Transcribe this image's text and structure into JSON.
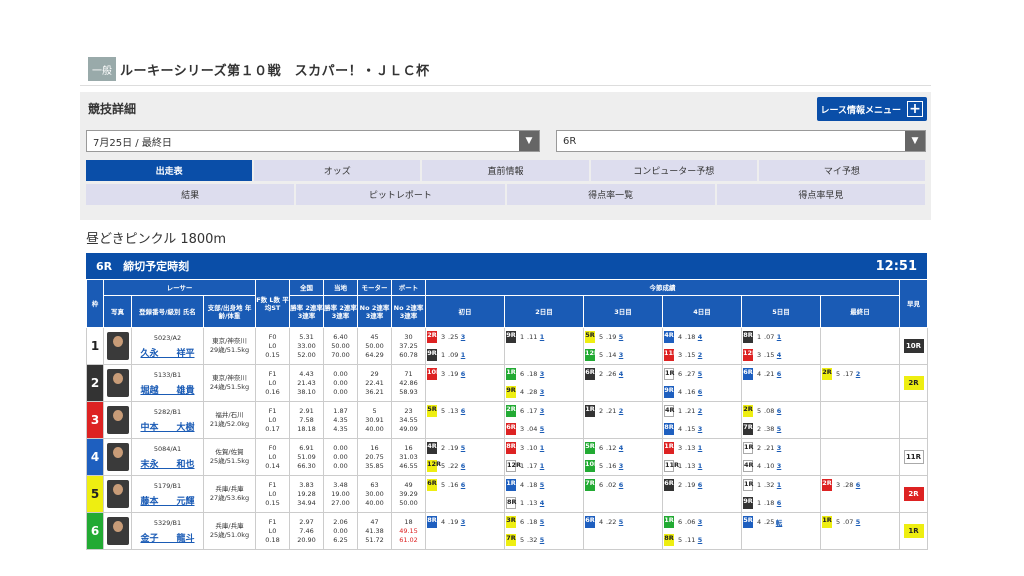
{
  "header": {
    "badge": "一般",
    "title": "ルーキーシリーズ第１０戦　スカパー！・ＪＬＣ杯"
  },
  "panel": {
    "title": "競技詳細",
    "menu_label": "レース情報メニュー",
    "date_select": "7月25日 / 最終日",
    "race_select": "6R"
  },
  "tabs_row1": [
    "出走表",
    "オッズ",
    "直前情報",
    "コンピューター予想",
    "マイ予想"
  ],
  "tabs_row2": [
    "結果",
    "ピットレポート",
    "得点率一覧",
    "得点率早見"
  ],
  "course": "昼どきピンクル 1800m",
  "racebar": {
    "label": "6R　締切予定時刻",
    "time": "12:51"
  },
  "table_headers": {
    "waku": "枠",
    "racer": "レーサー",
    "photo": "写真",
    "reg": "登録番号/級別 氏名",
    "branch": "支部/出身地 年齢/体重",
    "fl": "F数 L数 平均ST",
    "zenkoku": "全国",
    "touchi": "当地",
    "motor": "モーター",
    "boat": "ボート",
    "konsetsu": "今節成績",
    "rate1": "勝率 2連率 3連率",
    "rate2": "勝率 2連率 3連率",
    "rate3": "No 2連率 3連率",
    "rate4": "No 2連率 3連率",
    "days": [
      "初日",
      "2日目",
      "3日目",
      "4日目",
      "5日目",
      "最終日"
    ],
    "hayami": "早見"
  },
  "racers": [
    {
      "lane": "1",
      "reg": "5023/A2",
      "name": "久永　　祥平",
      "branch": "東京/神奈川",
      "age": "29歳/51.5kg",
      "f": "F0",
      "l": "L0",
      "st": "0.15",
      "zk": [
        "5.31",
        "33.00",
        "52.00"
      ],
      "tc": [
        "6.40",
        "50.00",
        "70.00"
      ],
      "mo": [
        "45",
        "50.00",
        "64.29"
      ],
      "bo": [
        "30",
        "37.25",
        "60.78"
      ],
      "days": [
        [
          [
            "2R",
            "c3"
          ],
          [
            "3",
            ".25",
            "3"
          ],
          [
            "9R",
            "c2"
          ],
          [
            "1",
            ".09",
            "1"
          ]
        ],
        [
          [
            "9R",
            "c2"
          ],
          [
            "1",
            ".11",
            "1"
          ]
        ],
        [
          [
            "5R",
            "c5"
          ],
          [
            "5",
            ".19",
            "5"
          ],
          [
            "12R",
            "c6"
          ],
          [
            "5",
            ".14",
            "3"
          ]
        ],
        [
          [
            "4R",
            "c4"
          ],
          [
            "4",
            ".18",
            "4"
          ],
          [
            "11R",
            "c3"
          ],
          [
            "3",
            ".15",
            "2"
          ]
        ],
        [
          [
            "8R",
            "c2"
          ],
          [
            "1",
            ".07",
            "1"
          ],
          [
            "12R",
            "c3"
          ],
          [
            "3",
            ".15",
            "4"
          ]
        ],
        []
      ],
      "early": [
        "10R",
        "c2"
      ]
    },
    {
      "lane": "2",
      "reg": "5133/B1",
      "name": "堀越　　雄貴",
      "branch": "東京/神奈川",
      "age": "24歳/51.5kg",
      "f": "F1",
      "l": "L0",
      "st": "0.16",
      "zk": [
        "4.43",
        "21.43",
        "38.10"
      ],
      "tc": [
        "0.00",
        "0.00",
        "0.00"
      ],
      "mo": [
        "29",
        "22.41",
        "36.21"
      ],
      "bo": [
        "71",
        "42.86",
        "58.93"
      ],
      "days": [
        [
          [
            "10R",
            "c3"
          ],
          [
            "3",
            ".19",
            "6"
          ]
        ],
        [
          [
            "1R",
            "c6"
          ],
          [
            "6",
            ".18",
            "3"
          ],
          [
            "9R",
            "c5"
          ],
          [
            "4",
            ".28",
            "3"
          ]
        ],
        [
          [
            "6R",
            "c2"
          ],
          [
            "2",
            ".26",
            "4"
          ]
        ],
        [
          [
            "1R",
            "c1"
          ],
          [
            "6",
            ".27",
            "5"
          ],
          [
            "9R",
            "c4"
          ],
          [
            "4",
            ".16",
            "6"
          ]
        ],
        [
          [
            "6R",
            "c4"
          ],
          [
            "4",
            ".21",
            "6"
          ]
        ],
        [
          [
            "2R",
            "c5"
          ],
          [
            "5",
            ".17",
            "2"
          ]
        ]
      ],
      "early": [
        "2R",
        "cy"
      ]
    },
    {
      "lane": "3",
      "reg": "5282/B1",
      "name": "中本　　大樹",
      "branch": "福井/石川",
      "age": "21歳/52.0kg",
      "f": "F1",
      "l": "L0",
      "st": "0.17",
      "zk": [
        "2.91",
        "7.58",
        "18.18"
      ],
      "tc": [
        "1.87",
        "4.35",
        "4.35"
      ],
      "mo": [
        "5",
        "30.91",
        "40.00"
      ],
      "bo": [
        "23",
        "34.55",
        "49.09"
      ],
      "days": [
        [
          [
            "5R",
            "c5"
          ],
          [
            "5",
            ".13",
            "6"
          ]
        ],
        [
          [
            "2R",
            "c6"
          ],
          [
            "6",
            ".17",
            "3"
          ],
          [
            "6R",
            "c3"
          ],
          [
            "3",
            ".04",
            "5"
          ]
        ],
        [
          [
            "1R",
            "c2"
          ],
          [
            "2",
            ".21",
            "2"
          ]
        ],
        [
          [
            "4R",
            "c1"
          ],
          [
            "1",
            ".21",
            "2"
          ],
          [
            "8R",
            "c4"
          ],
          [
            "4",
            ".15",
            "3"
          ]
        ],
        [
          [
            "2R",
            "c5"
          ],
          [
            "5",
            ".08",
            "6"
          ],
          [
            "7R",
            "c2"
          ],
          [
            "2",
            ".38",
            "5"
          ]
        ],
        []
      ],
      "early": [
        "",
        ""
      ]
    },
    {
      "lane": "4",
      "reg": "5084/A1",
      "name": "末永　　和也",
      "branch": "佐賀/佐賀",
      "age": "25歳/51.5kg",
      "f": "F0",
      "l": "L0",
      "st": "0.14",
      "zk": [
        "6.91",
        "51.09",
        "66.30"
      ],
      "tc": [
        "0.00",
        "0.00",
        "0.00"
      ],
      "mo": [
        "16",
        "20.75",
        "35.85"
      ],
      "bo": [
        "16",
        "31.03",
        "46.55"
      ],
      "days": [
        [
          [
            "4R",
            "c2"
          ],
          [
            "2",
            ".19",
            "5"
          ],
          [
            "12R",
            "c5"
          ],
          [
            "5",
            ".22",
            "6"
          ]
        ],
        [
          [
            "8R",
            "c3"
          ],
          [
            "3",
            ".10",
            "1"
          ],
          [
            "12R",
            "c1"
          ],
          [
            "1",
            ".17",
            "1"
          ]
        ],
        [
          [
            "5R",
            "c6"
          ],
          [
            "6",
            ".12",
            "4"
          ],
          [
            "10R",
            "c6"
          ],
          [
            "5",
            ".16",
            "3"
          ]
        ],
        [
          [
            "1R",
            "c3"
          ],
          [
            "3",
            ".13",
            "1"
          ],
          [
            "11R",
            "c1"
          ],
          [
            "1",
            ".13",
            "1"
          ]
        ],
        [
          [
            "1R",
            "c1"
          ],
          [
            "2",
            ".21",
            "3"
          ],
          [
            "4R",
            "c1"
          ],
          [
            "4",
            ".10",
            "3"
          ]
        ],
        []
      ],
      "early": [
        "11R",
        "c1"
      ]
    },
    {
      "lane": "5",
      "reg": "5179/B1",
      "name": "藤本　　元輝",
      "branch": "兵庫/兵庫",
      "age": "27歳/53.6kg",
      "f": "F1",
      "l": "L0",
      "st": "0.15",
      "zk": [
        "3.83",
        "19.28",
        "34.94"
      ],
      "tc": [
        "3.48",
        "19.00",
        "27.00"
      ],
      "mo": [
        "63",
        "30.00",
        "40.00"
      ],
      "bo": [
        "49",
        "39.29",
        "50.00"
      ],
      "days": [
        [
          [
            "6R",
            "c5"
          ],
          [
            "5",
            ".16",
            "6"
          ]
        ],
        [
          [
            "1R",
            "c4"
          ],
          [
            "4",
            ".18",
            "5"
          ],
          [
            "8R",
            "c1"
          ],
          [
            "1",
            ".13",
            "4"
          ]
        ],
        [
          [
            "7R",
            "c6"
          ],
          [
            "6",
            ".02",
            "6"
          ]
        ],
        [
          [
            "6R",
            "c2"
          ],
          [
            "2",
            ".19",
            "6"
          ]
        ],
        [
          [
            "1R",
            "c1"
          ],
          [
            "1",
            ".32",
            "1"
          ],
          [
            "9R",
            "c2"
          ],
          [
            "1",
            ".18",
            "6"
          ]
        ],
        [
          [
            "2R",
            "c3"
          ],
          [
            "3",
            ".28",
            "6"
          ]
        ]
      ],
      "early": [
        "2R",
        "c3"
      ]
    },
    {
      "lane": "6",
      "reg": "5329/B1",
      "name": "金子　　龍斗",
      "branch": "兵庫/兵庫",
      "age": "25歳/51.0kg",
      "f": "F1",
      "l": "L0",
      "st": "0.18",
      "zk": [
        "2.97",
        "7.46",
        "20.90"
      ],
      "tc": [
        "2.06",
        "0.00",
        "6.25"
      ],
      "mo": [
        "47",
        "41.38",
        "51.72"
      ],
      "bo": [
        "18",
        "49.15",
        "61.02"
      ],
      "days": [
        [
          [
            "8R",
            "c4"
          ],
          [
            "4",
            ".19",
            "3"
          ]
        ],
        [
          [
            "3R",
            "c5"
          ],
          [
            "6",
            ".18",
            "5"
          ],
          [
            "7R",
            "c5"
          ],
          [
            "5",
            ".32",
            "5"
          ]
        ],
        [
          [
            "6R",
            "c4"
          ],
          [
            "4",
            ".22",
            "5"
          ]
        ],
        [
          [
            "1R",
            "c6"
          ],
          [
            "6",
            ".06",
            "3"
          ],
          [
            "8R",
            "c5"
          ],
          [
            "5",
            ".11",
            "5"
          ]
        ],
        [
          [
            "5R",
            "c4"
          ],
          [
            "4",
            ".25",
            "転"
          ]
        ],
        [
          [
            "1R",
            "c5"
          ],
          [
            "5",
            ".07",
            "5"
          ]
        ]
      ],
      "early": [
        "1R",
        "cy"
      ]
    }
  ],
  "colors": {
    "accent": "#0a4ea8",
    "lane1": "#ffffff",
    "lane2": "#333333",
    "lane3": "#dd2222",
    "lane4": "#1e5fbf",
    "lane5": "#eeee11",
    "lane6": "#22aa33"
  }
}
